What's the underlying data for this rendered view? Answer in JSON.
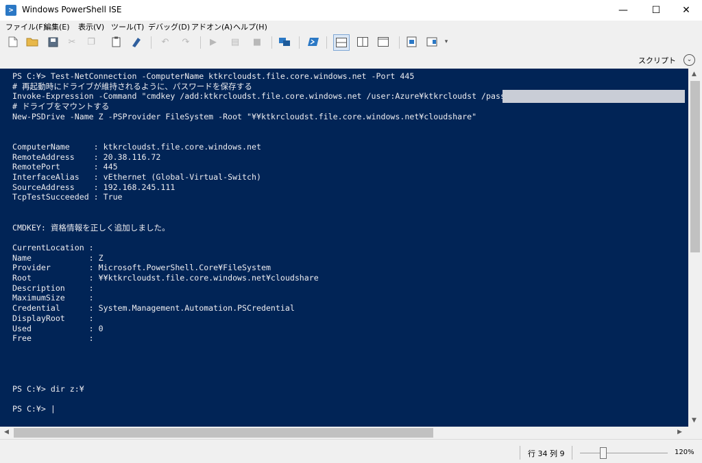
{
  "window": {
    "title": "Windows PowerShell ISE",
    "minimize": "—",
    "maximize": "☐",
    "close": "✕"
  },
  "menu": [
    "ファイル(F)",
    "編集(E)",
    "表示(V)",
    "ツール(T)",
    "デバッグ(D)",
    "アドオン(A)",
    "ヘルプ(H)"
  ],
  "toolbar": {
    "icons": [
      "new-file-icon",
      "open-icon",
      "save-icon",
      "cut-icon",
      "copy-icon",
      "paste-icon",
      "clear-console-icon",
      "undo-icon",
      "redo-icon",
      "run-icon",
      "run-selection-icon",
      "stop-icon",
      "remote-powershell-icon",
      "powershell-icon",
      "layout-top-icon",
      "layout-right-icon",
      "layout-max-icon",
      "show-script-icon",
      "show-commands-icon"
    ]
  },
  "script_pane": {
    "label": "スクリプト",
    "expand_icon": "chevron-down-icon"
  },
  "console": {
    "text": "PS C:¥> Test-NetConnection -ComputerName ktkrcloudst.file.core.windows.net -Port 445\n# 再起動時にドライブが維持されるように、パスワードを保存する\nInvoke-Expression -Command \"cmdkey /add:ktkrcloudst.file.core.windows.net /user:Azure¥ktkrcloudst /pass:\n# ドライブをマウントする\nNew-PSDrive -Name Z -PSProvider FileSystem -Root \"¥¥ktkrcloudst.file.core.windows.net¥cloudshare\"\n\n\nComputerName     : ktkrcloudst.file.core.windows.net\nRemoteAddress    : 20.38.116.72\nRemotePort       : 445\nInterfaceAlias   : vEthernet (Global-Virtual-Switch)\nSourceAddress    : 192.168.245.111\nTcpTestSucceeded : True\n\n\nCMDKEY: 資格情報を正しく追加しました。\n\nCurrentLocation :\nName            : Z\nProvider        : Microsoft.PowerShell.Core¥FileSystem\nRoot            : ¥¥ktkrcloudst.file.core.windows.net¥cloudshare\nDescription     :\nMaximumSize     :\nCredential      : System.Management.Automation.PSCredential\nDisplayRoot     :\nUsed            : 0\nFree            :\n\n\n\n\nPS C:¥> dir z:¥\n\nPS C:¥> |"
  },
  "status": {
    "position": "行 34  列 9",
    "zoom_value": 120,
    "zoom_label": "120%"
  },
  "colors": {
    "console_bg": "#012456",
    "console_fg": "#eeedf0"
  }
}
